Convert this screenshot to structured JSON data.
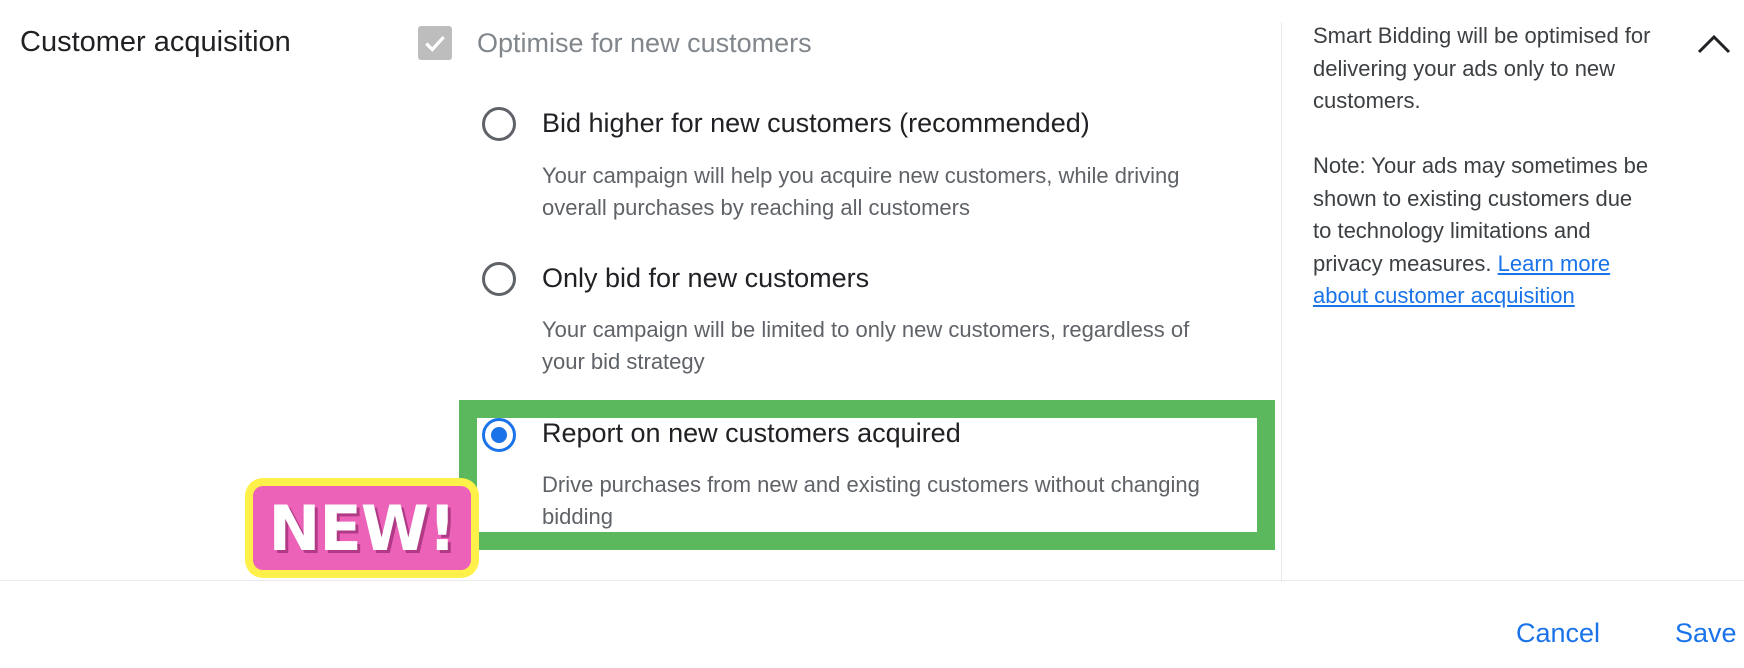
{
  "section": {
    "title": "Customer acquisition"
  },
  "checkbox": {
    "label": "Optimise for new customers",
    "checked": true
  },
  "options": [
    {
      "title": "Bid higher for new customers (recommended)",
      "description": "Your campaign will help you acquire new customers, while driving overall purchases by reaching all customers",
      "selected": false
    },
    {
      "title": "Only bid for new customers",
      "description": "Your campaign will be limited to only new customers, regardless of your bid strategy",
      "selected": false
    },
    {
      "title": "Report on new customers acquired",
      "description": "Drive purchases from new and existing customers without changing bidding",
      "selected": true
    }
  ],
  "badge": {
    "text": "NEW!"
  },
  "help": {
    "paragraph1": "Smart Bidding will be optimised for delivering your ads only to new customers.",
    "paragraph2": "Note: Your ads may sometimes be shown to existing customers due to technology limitations and privacy measures.",
    "link": "Learn more about customer acquisition"
  },
  "footer": {
    "cancel": "Cancel",
    "save": "Save"
  },
  "colors": {
    "accent": "#1a73e8",
    "highlight_border": "#5cb85c",
    "badge_fill": "#ec62b8",
    "badge_outline": "#fff14a"
  },
  "icons": {
    "checkbox": "check-icon",
    "collapse": "chevron-up-icon"
  }
}
